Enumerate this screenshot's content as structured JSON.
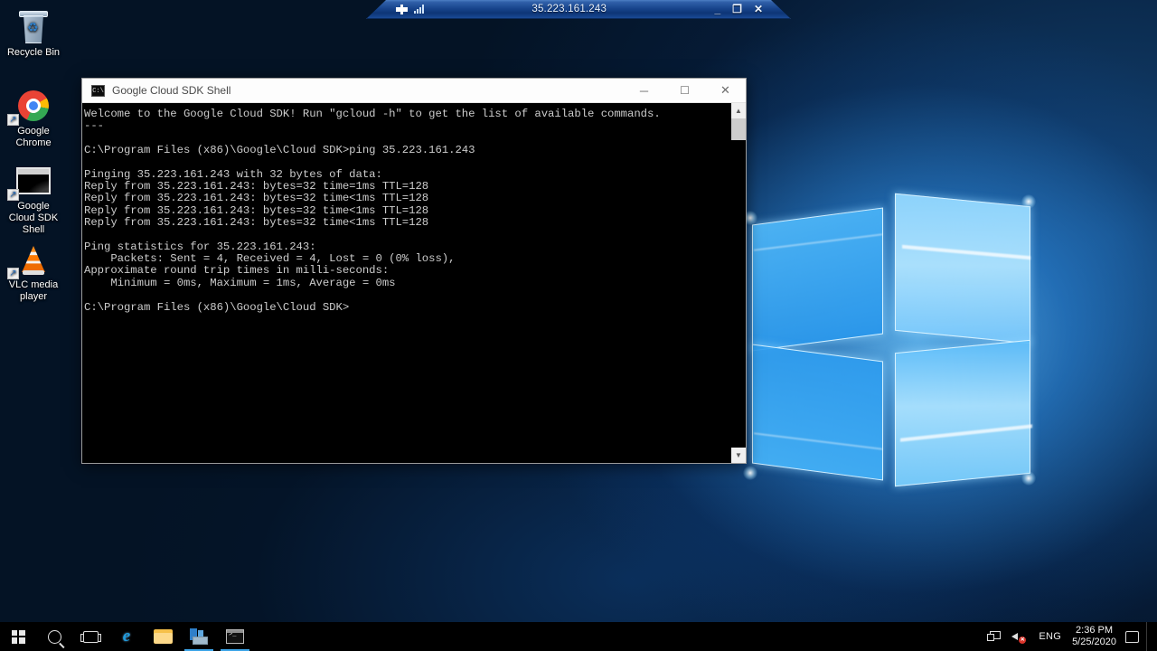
{
  "rdp_bar": {
    "title": "35.223.161.243",
    "pin_icon": "pushpin-icon",
    "signal_icon": "signal-bars-icon",
    "minimize_label": "_",
    "restore_label": "❐",
    "close_label": "✕"
  },
  "desktop": {
    "icons": [
      {
        "name": "recycle-bin",
        "label": "Recycle Bin",
        "shortcut": false
      },
      {
        "name": "google-chrome",
        "label": "Google\nChrome",
        "shortcut": true
      },
      {
        "name": "google-cloud-sdk-shell",
        "label": "Google\nCloud SDK\nShell",
        "shortcut": true
      },
      {
        "name": "vlc-media-player",
        "label": "VLC media\nplayer",
        "shortcut": true
      }
    ],
    "shortcut_arrow_glyph": "↗"
  },
  "console_window": {
    "title": "Google Cloud SDK Shell",
    "title_icon": "console-icon",
    "icon_text": "C:\\",
    "controls": {
      "minimize": "─",
      "maximize": "☐",
      "close": "✕"
    },
    "scrollbar": {
      "up_arrow": "▲",
      "down_arrow": "▼"
    },
    "content": "Welcome to the Google Cloud SDK! Run \"gcloud -h\" to get the list of available commands.\n---\n\nC:\\Program Files (x86)\\Google\\Cloud SDK>ping 35.223.161.243\n\nPinging 35.223.161.243 with 32 bytes of data:\nReply from 35.223.161.243: bytes=32 time=1ms TTL=128\nReply from 35.223.161.243: bytes=32 time<1ms TTL=128\nReply from 35.223.161.243: bytes=32 time<1ms TTL=128\nReply from 35.223.161.243: bytes=32 time<1ms TTL=128\n\nPing statistics for 35.223.161.243:\n    Packets: Sent = 4, Received = 4, Lost = 0 (0% loss),\nApproximate round trip times in milli-seconds:\n    Minimum = 0ms, Maximum = 1ms, Average = 0ms\n\nC:\\Program Files (x86)\\Google\\Cloud SDK>"
  },
  "taskbar": {
    "items": [
      {
        "name": "start-button",
        "icon": "windows-logo-icon",
        "running": false
      },
      {
        "name": "search-button",
        "icon": "search-icon",
        "running": false
      },
      {
        "name": "task-view-button",
        "icon": "task-view-icon",
        "running": false
      },
      {
        "name": "internet-explorer",
        "icon": "internet-explorer-icon",
        "running": false,
        "glyph": "e"
      },
      {
        "name": "file-explorer",
        "icon": "folder-icon",
        "running": false
      },
      {
        "name": "server-manager",
        "icon": "server-manager-icon",
        "running": true
      },
      {
        "name": "command-prompt",
        "icon": "command-prompt-icon",
        "running": true
      }
    ],
    "tray": {
      "network_icon": "network-monitor-icon",
      "volume_icon": "speaker-muted-icon",
      "mute_badge": "✕",
      "language": "ENG",
      "time": "2:36 PM",
      "date": "5/25/2020",
      "action_center_icon": "action-center-icon"
    }
  }
}
